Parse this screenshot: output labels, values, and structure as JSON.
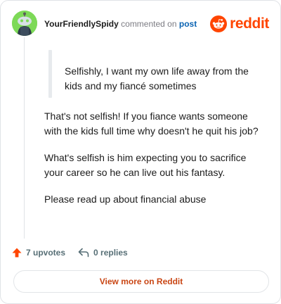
{
  "comment": {
    "username": "YourFriendlySpidy",
    "action_text": "commented on",
    "post_link": "post",
    "quote": "Selfishly, I want my own life away from the kids and my fiancé sometimes",
    "paragraphs": [
      "That's not selfish! If you fiance wants someone with the kids full time why doesn't he quit his job?",
      "What's selfish is him expecting you to sacrifice your career so he can live out his fantasy.",
      "Please read up about financial abuse"
    ]
  },
  "logo": {
    "wordmark": "reddit",
    "icon": "reddit-snoo-icon",
    "color": "#ff4500"
  },
  "actions": {
    "upvotes": "7 upvotes",
    "replies": "0 replies",
    "upvote_icon": "upvote-arrow-icon",
    "reply_icon": "reply-arrow-icon",
    "upvote_color": "#ff4500"
  },
  "cta": {
    "label": "View more on Reddit",
    "color": "#c94614"
  },
  "colors": {
    "avatar_bg": "#7dd957",
    "link": "#0b64b3"
  }
}
